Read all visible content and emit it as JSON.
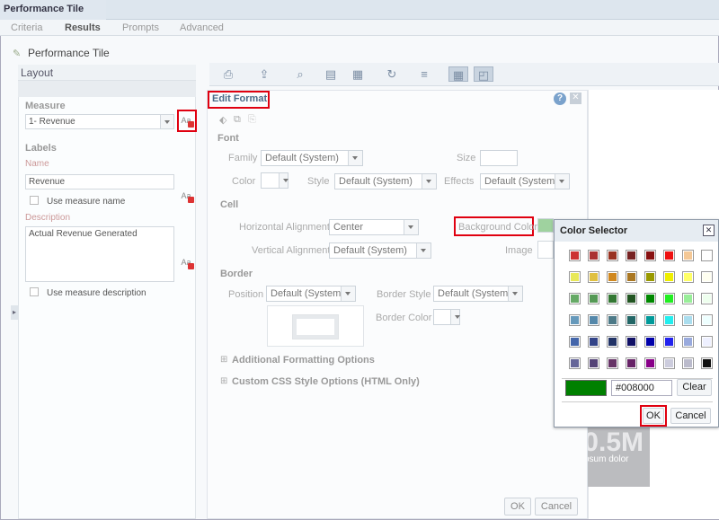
{
  "window": {
    "title": "Performance Tile"
  },
  "tabs": [
    {
      "label": "Criteria"
    },
    {
      "label": "Results"
    },
    {
      "label": "Prompts"
    },
    {
      "label": "Advanced"
    }
  ],
  "page": {
    "title": "Performance Tile"
  },
  "layout": {
    "header": "Layout",
    "measure_label": "Measure",
    "measure_value": "1- Revenue",
    "labels_heading": "Labels",
    "name_label": "Name",
    "name_value": "Revenue",
    "use_measure_name": "Use measure name",
    "description_label": "Description",
    "description_value": "Actual Revenue Generated",
    "use_measure_description": "Use measure description"
  },
  "edit_format": {
    "title": "Edit Format",
    "font_section": "Font",
    "family_label": "Family",
    "family_value": "Default (System)",
    "size_label": "Size",
    "size_value": "",
    "color_label": "Color",
    "style_label": "Style",
    "style_value": "Default (System)",
    "effects_label": "Effects",
    "effects_value": "Default (System)",
    "cell_section": "Cell",
    "halign_label": "Horizontal Alignment",
    "halign_value": "Center",
    "bgcolor_label": "Background Color",
    "valign_label": "Vertical Alignment",
    "valign_value": "Default (System)",
    "image_label": "Image",
    "border_section": "Border",
    "position_label": "Position",
    "position_value": "Default (System)",
    "border_style_label": "Border Style",
    "border_style_value": "Default (System)",
    "border_color_label": "Border Color",
    "additional_options": "Additional Formatting Options",
    "custom_css": "Custom CSS Style Options (HTML Only)",
    "ok": "OK",
    "cancel": "Cancel"
  },
  "color_selector": {
    "title": "Color Selector",
    "hex_value": "#008000",
    "clear": "Clear",
    "ok": "OK",
    "cancel": "Cancel",
    "selected_color": "#008000",
    "swatches": [
      [
        "#cc3333",
        "#aa3333",
        "#993322",
        "#772222",
        "#881111",
        "#ee1111",
        "#f4c896",
        "#ffffff"
      ],
      [
        "#e8e858",
        "#e0c040",
        "#d08820",
        "#aa7722",
        "#999900",
        "#eeee00",
        "#ffff66",
        "#fffff0"
      ],
      [
        "#66aa66",
        "#559955",
        "#337733",
        "#225522",
        "#008800",
        "#22ee22",
        "#99ee99",
        "#eeffee"
      ],
      [
        "#6699bb",
        "#5588aa",
        "#4d7a88",
        "#226666",
        "#009999",
        "#22eeee",
        "#aaddee",
        "#eeffff"
      ],
      [
        "#4466aa",
        "#334488",
        "#223366",
        "#111166",
        "#0000aa",
        "#2222ee",
        "#99aadd",
        "#eef0ff"
      ],
      [
        "#666699",
        "#554477",
        "#663366",
        "#662266",
        "#880088",
        "#ccccdd",
        "#bbbbcc",
        "#111111"
      ]
    ]
  },
  "preview": {
    "value_fragment": "0.5M",
    "text_fragment": "psum dolor"
  }
}
